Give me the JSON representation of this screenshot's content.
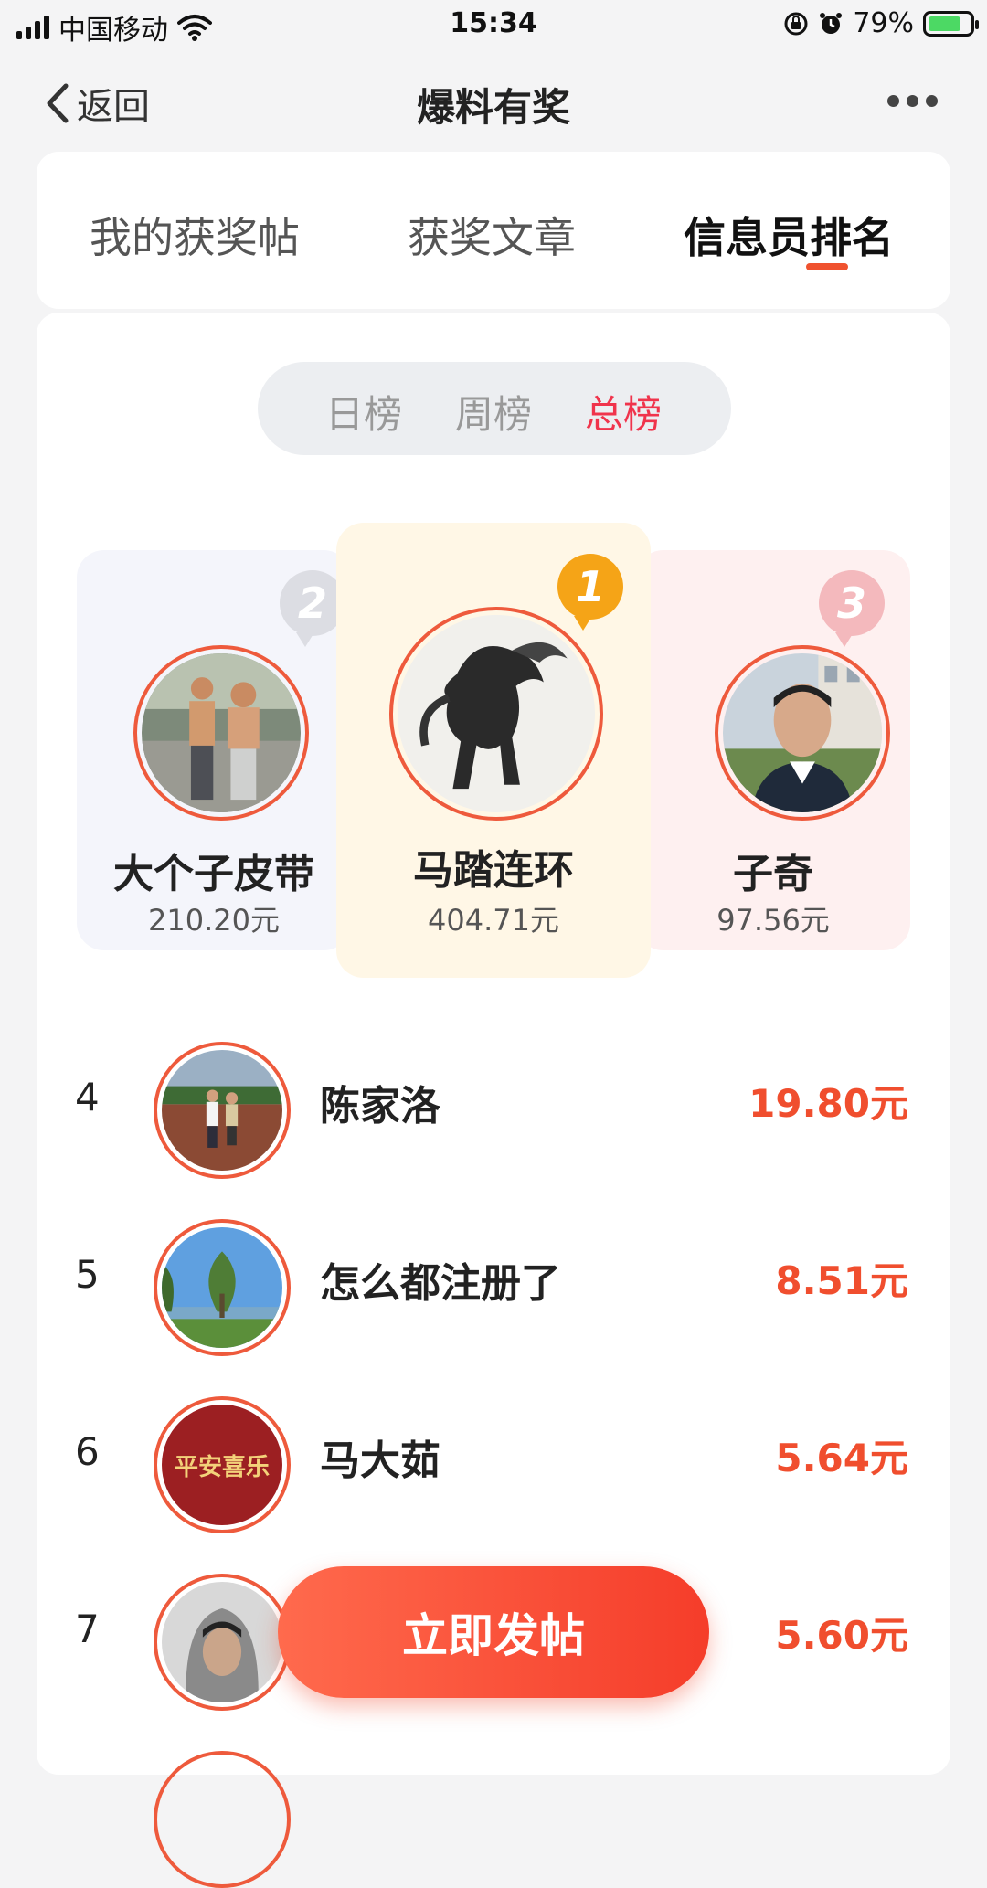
{
  "status_bar": {
    "carrier": "中国移动",
    "time": "15:34",
    "battery_pct": "79%",
    "battery_level": 0.79
  },
  "nav": {
    "back_label": "返回",
    "title": "爆料有奖"
  },
  "tabs": [
    {
      "label": "我的获奖帖",
      "active": false
    },
    {
      "label": "获奖文章",
      "active": false
    },
    {
      "label": "信息员排名",
      "active": true
    }
  ],
  "segment": [
    {
      "label": "日榜",
      "active": false
    },
    {
      "label": "周榜",
      "active": false
    },
    {
      "label": "总榜",
      "active": true
    }
  ],
  "podium": [
    {
      "rank": "1",
      "name": "马踏连环",
      "amount": "404.71元",
      "avatar": "horse-ink-painting"
    },
    {
      "rank": "2",
      "name": "大个子皮带",
      "amount": "210.20元",
      "avatar": "two-men-photo"
    },
    {
      "rank": "3",
      "name": "子奇",
      "amount": "97.56元",
      "avatar": "man-portrait"
    }
  ],
  "list": [
    {
      "rank": "4",
      "name": "陈家洛",
      "amount": "19.80元",
      "avatar": "couple-outdoors"
    },
    {
      "rank": "5",
      "name": "怎么都注册了",
      "amount": "8.51元",
      "avatar": "lake-trees"
    },
    {
      "rank": "6",
      "name": "马大茹",
      "amount": "5.64元",
      "avatar": "ping-an-xi-le",
      "avatar_text": "平安喜乐"
    },
    {
      "rank": "7",
      "name": "",
      "amount": "5.60元",
      "avatar": "hooded-person"
    }
  ],
  "post_button": "立即发帖",
  "colors": {
    "accent": "#f0522f",
    "segment_active": "#f0344c",
    "amount": "#f04e2e",
    "gold": "#f5a417"
  }
}
